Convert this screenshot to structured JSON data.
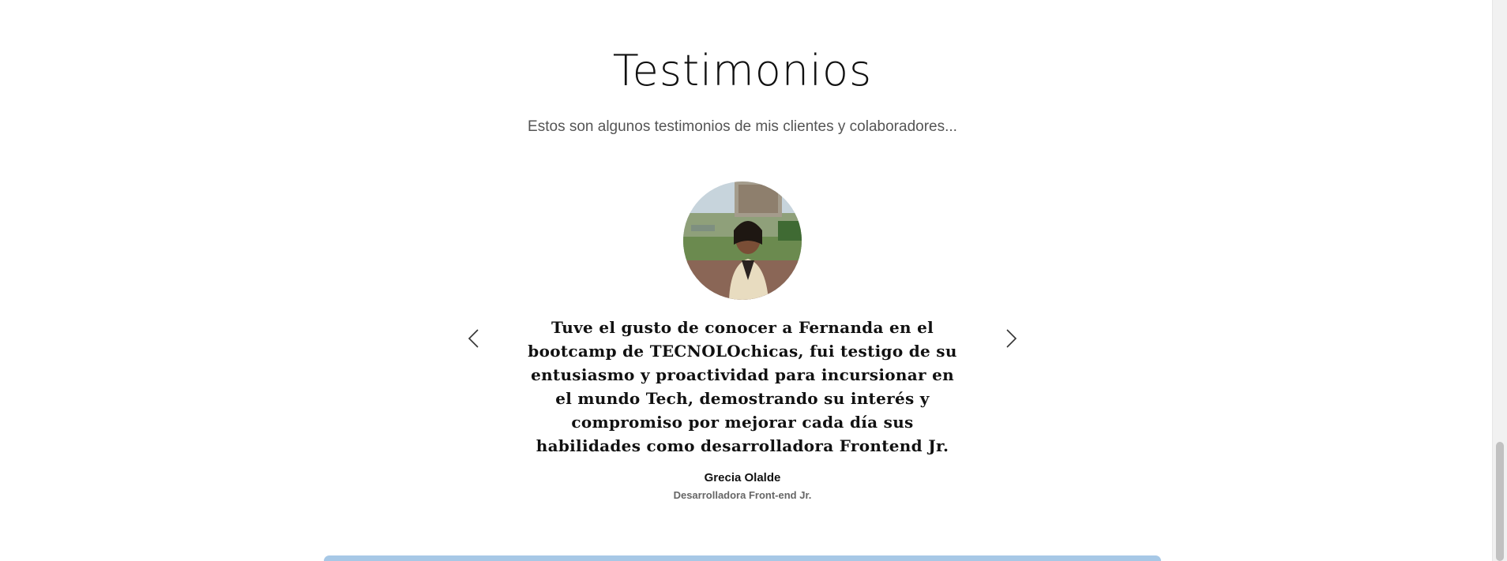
{
  "section": {
    "title": "Testimonios",
    "subtitle": "Estos son algunos testimonios de mis clientes y colaboradores..."
  },
  "testimonial": {
    "quote": "Tuve el gusto de conocer a Fernanda en el bootcamp de TECNOLOchicas, fui testigo de su entusiasmo y proactividad para incursionar en el mundo Tech, demostrando su interés y compromiso por mejorar cada día sus habilidades como desarrolladora Frontend Jr.",
    "author": "Grecia Olalde",
    "role": "Desarrolladora Front-end Jr."
  },
  "icons": {
    "prev": "chevron-left-icon",
    "next": "chevron-right-icon"
  },
  "colors": {
    "bottom_bar": "#a7c8e6",
    "subtitle_text": "#555555"
  }
}
